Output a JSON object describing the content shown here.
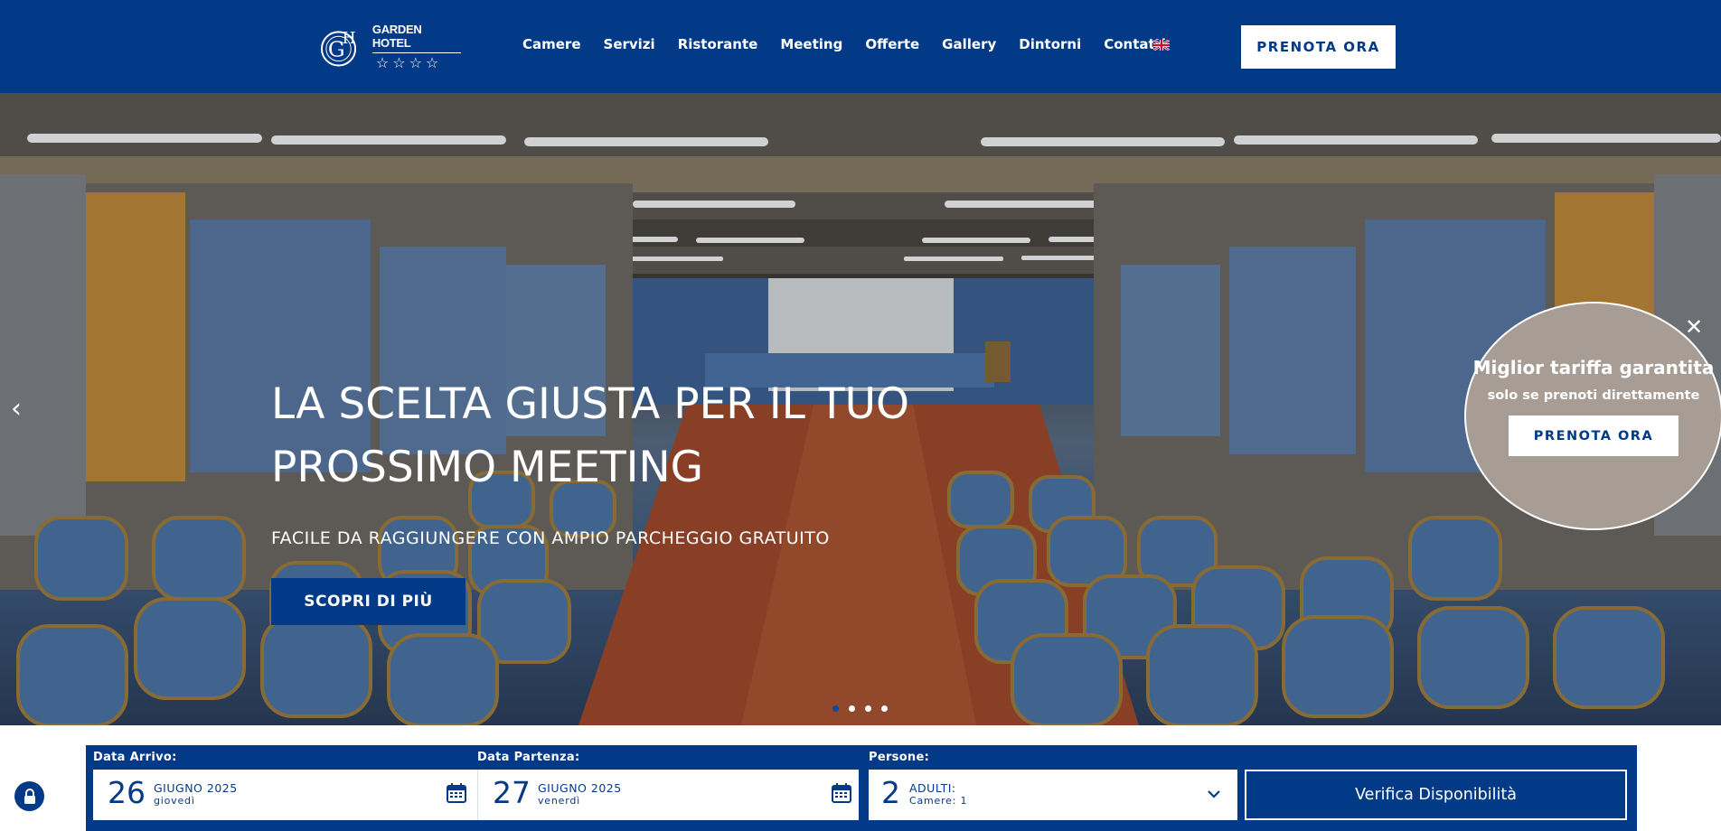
{
  "header": {
    "logo_name": "GARDEN HOTEL",
    "logo_monogram": "GH",
    "logo_stars": "☆☆☆☆",
    "nav": [
      "Camere",
      "Servizi",
      "Ristorante",
      "Meeting",
      "Offerte",
      "Gallery",
      "Dintorni",
      "Contatti"
    ],
    "language_icon": "uk-flag-icon",
    "cta": "PRENOTA ORA"
  },
  "hero": {
    "title_line1": "LA SCELTA GIUSTA PER IL TUO",
    "title_line2": "PROSSIMO MEETING",
    "subtitle": "FACILE DA RAGGIUNGERE CON AMPIO PARCHEGGIO GRATUITO",
    "button": "SCOPRI DI PIÙ",
    "prev_icon": "chevron-left-icon",
    "slides_total": 4,
    "active_slide": 1
  },
  "promo": {
    "title": "Miglior tariffa garantita",
    "subtitle": "solo se prenoti direttamente",
    "button": "PRENOTA ORA",
    "close_icon": "close-icon"
  },
  "booking": {
    "arrivo_label": "Data Arrivo:",
    "arrivo_day": "26",
    "arrivo_month": "GIUGNO 2025",
    "arrivo_weekday": "giovedì",
    "partenza_label": "Data Partenza:",
    "partenza_day": "27",
    "partenza_month": "GIUGNO 2025",
    "partenza_weekday": "venerdì",
    "persone_label": "Persone:",
    "persone_count": "2",
    "persone_type": "ADULTI:",
    "camere": "Camere: 1",
    "verify_button": "Verifica Disponibilità"
  },
  "colors": {
    "brand_blue": "#033a87",
    "promo_taupe": "#a79d95",
    "white": "#ffffff"
  }
}
